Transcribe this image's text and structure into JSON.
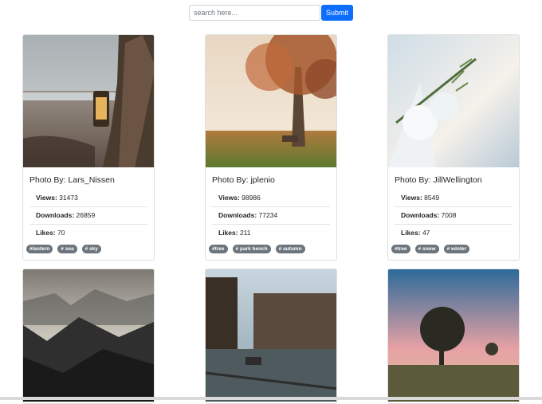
{
  "search": {
    "placeholder": "search here...",
    "submit_label": "Submit"
  },
  "labels": {
    "photo_by": "Photo By:",
    "views": "Views:",
    "downloads": "Downloads:",
    "likes": "Likes:"
  },
  "cards": [
    {
      "author": "Lars_Nissen",
      "views": "31473",
      "downloads": "26859",
      "likes": "70",
      "tags": [
        "#lantern",
        "# sea",
        "# sky"
      ]
    },
    {
      "author": "jplenio",
      "views": "98986",
      "downloads": "77234",
      "likes": "211",
      "tags": [
        "#tree",
        "# park bench",
        "# autumn"
      ]
    },
    {
      "author": "JillWellington",
      "views": "8549",
      "downloads": "7008",
      "likes": "47",
      "tags": [
        "#tree",
        "# snow",
        "# winter"
      ]
    },
    {
      "author": "",
      "views": "",
      "downloads": "",
      "likes": "",
      "tags": []
    },
    {
      "author": "",
      "views": "",
      "downloads": "",
      "likes": "",
      "tags": []
    },
    {
      "author": "",
      "views": "",
      "downloads": "",
      "likes": "",
      "tags": []
    }
  ]
}
